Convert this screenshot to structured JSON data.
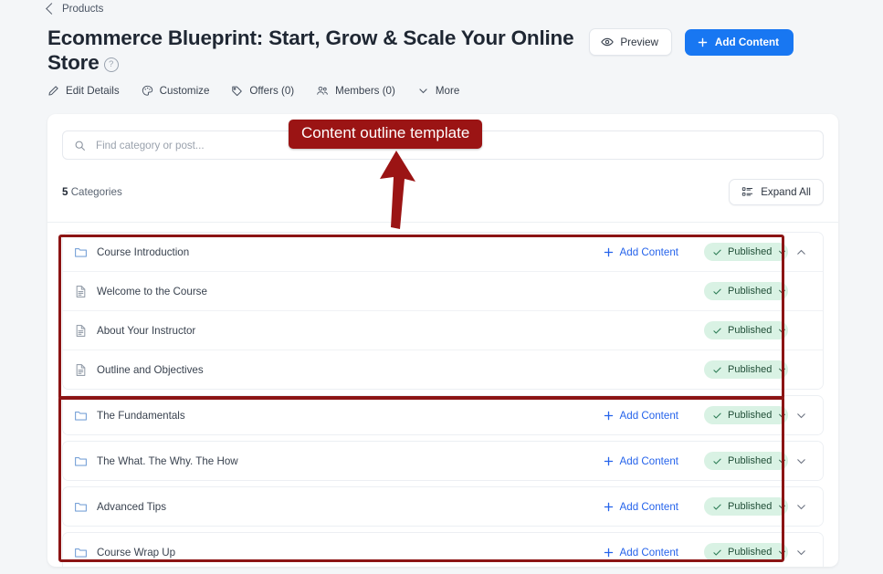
{
  "breadcrumb": {
    "icon": "chevron-left-icon",
    "label": "Products"
  },
  "page": {
    "title": "Ecommerce Blueprint: Start, Grow & Scale Your Online Store",
    "help_icon": "question-mark-icon",
    "help_glyph": "?"
  },
  "header_actions": {
    "preview": {
      "label": "Preview",
      "icon": "eye-icon"
    },
    "add_content": {
      "label": "Add Content",
      "icon": "plus-icon",
      "color": "#1877f2"
    }
  },
  "tabs": [
    {
      "label": "Edit Details",
      "icon": "pencil-icon"
    },
    {
      "label": "Customize",
      "icon": "palette-icon"
    },
    {
      "label": "Offers (0)",
      "icon": "tag-icon"
    },
    {
      "label": "Members (0)",
      "icon": "people-icon"
    },
    {
      "label": "More",
      "icon": "chevron-down-icon"
    }
  ],
  "search": {
    "placeholder": "Find category or post...",
    "value": "",
    "icon": "search-icon"
  },
  "toolbar": {
    "count_number": "5",
    "count_label": "Categories",
    "expand_all_label": "Expand All",
    "expand_all_icon": "list-layout-icon"
  },
  "common": {
    "add_content_label": "Add Content",
    "published_label": "Published",
    "check_icon": "check-icon",
    "badge_chevron_icon": "chevron-down-icon",
    "folder_icon": "folder-icon",
    "document_icon": "document-icon"
  },
  "outline": {
    "groups": [
      {
        "title": "Course Introduction",
        "icon": "folder-icon",
        "expanded": true,
        "chevron": "chevron-up-icon",
        "add_content_label": "Add Content",
        "status": "Published",
        "items": [
          {
            "title": "Welcome to the Course",
            "icon": "document-icon",
            "status": "Published"
          },
          {
            "title": "About Your Instructor",
            "icon": "document-icon",
            "status": "Published"
          },
          {
            "title": "Outline and Objectives",
            "icon": "document-icon",
            "status": "Published"
          }
        ]
      },
      {
        "title": "The Fundamentals",
        "icon": "folder-icon",
        "expanded": false,
        "chevron": "chevron-down-icon",
        "add_content_label": "Add Content",
        "status": "Published",
        "items": []
      },
      {
        "title": "The What. The Why. The How",
        "icon": "folder-icon",
        "expanded": false,
        "chevron": "chevron-down-icon",
        "add_content_label": "Add Content",
        "status": "Published",
        "items": []
      },
      {
        "title": "Advanced Tips",
        "icon": "folder-icon",
        "expanded": false,
        "chevron": "chevron-down-icon",
        "add_content_label": "Add Content",
        "status": "Published",
        "items": []
      },
      {
        "title": "Course Wrap Up",
        "icon": "folder-icon",
        "expanded": false,
        "chevron": "chevron-down-icon",
        "add_content_label": "Add Content",
        "status": "Published",
        "items": []
      }
    ]
  },
  "annotations": {
    "label": "Content outline template",
    "color": "#9b1414",
    "arrow_icon": "arrow-up-icon",
    "highlight_boxes": 2
  }
}
